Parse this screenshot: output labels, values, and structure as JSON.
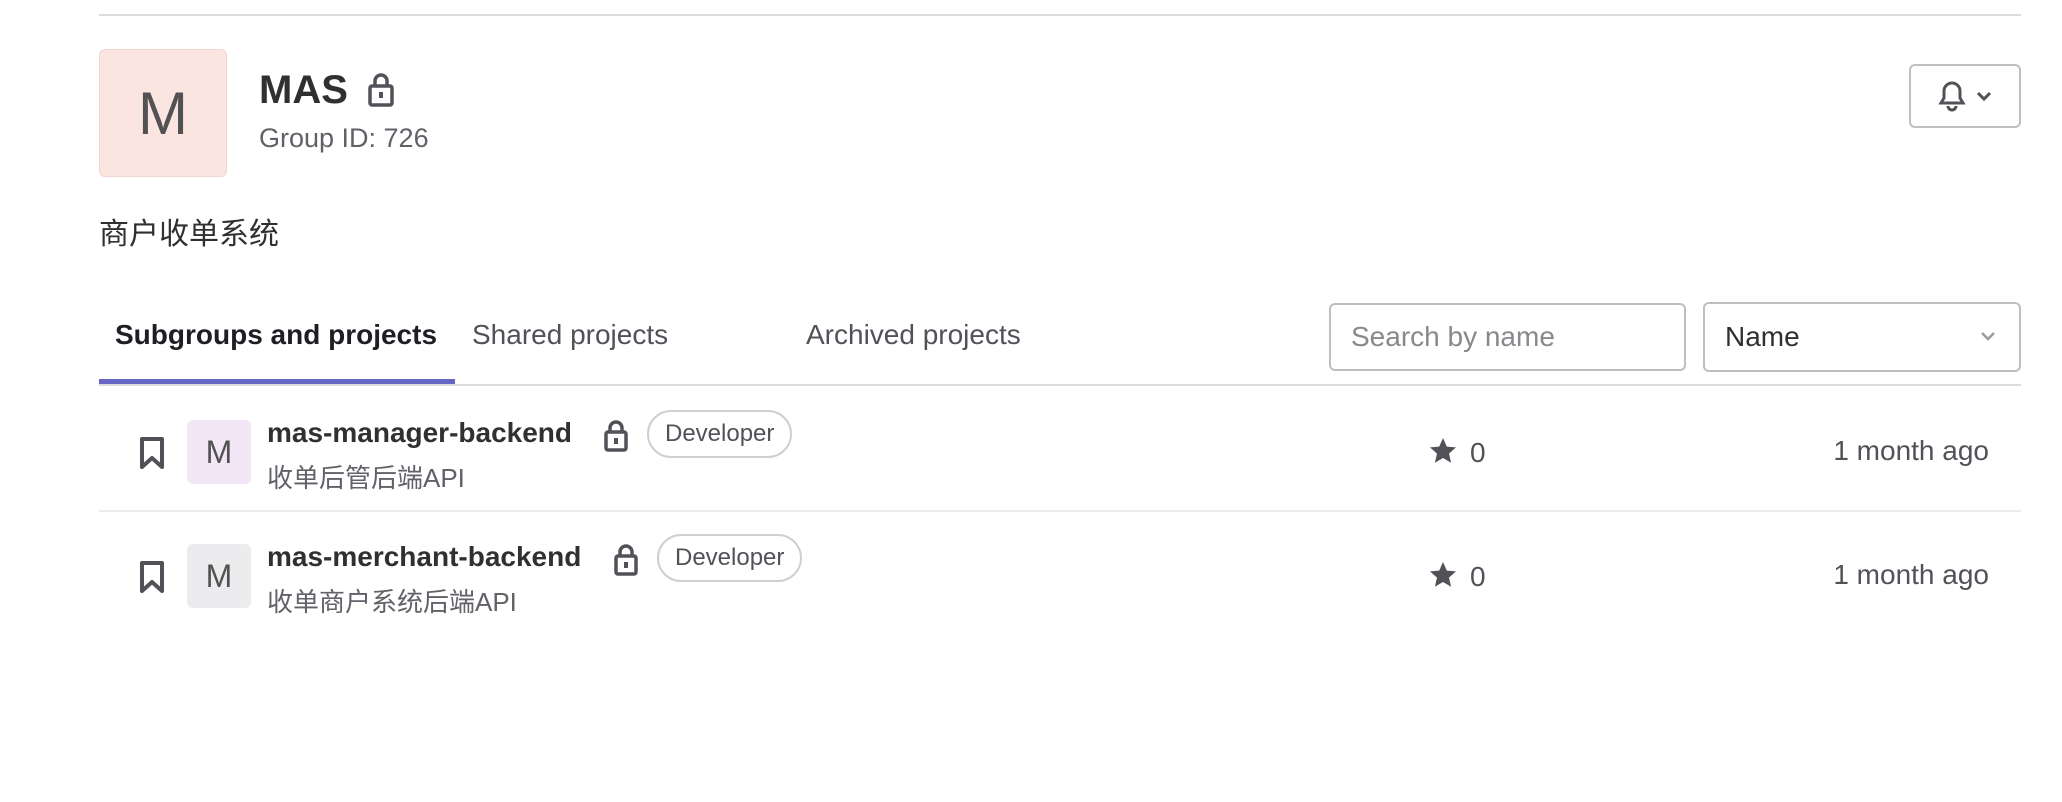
{
  "group": {
    "avatar_letter": "M",
    "name": "MAS",
    "id_text": "Group ID: 726",
    "description": "商户收单系统",
    "visibility_icon": "lock-icon",
    "avatar_color": "#fbe5e1"
  },
  "notifications": {
    "icon": "bell-icon",
    "dropdown_icon": "chevron-down-icon"
  },
  "tabs": [
    {
      "label": "Subgroups and projects",
      "active": true
    },
    {
      "label": "Shared projects",
      "active": false
    },
    {
      "label": "Archived projects",
      "active": false
    }
  ],
  "search": {
    "placeholder": "Search by name",
    "value": ""
  },
  "sort": {
    "selected": "Name"
  },
  "projects": [
    {
      "avatar_letter": "M",
      "avatar_color": "#f3e6f6",
      "name": "mas-manager-backend",
      "role": "Developer",
      "description": "收单后管后端API",
      "stars": "0",
      "updated": "1 month ago"
    },
    {
      "avatar_letter": "M",
      "avatar_color": "#ececef",
      "name": "mas-merchant-backend",
      "role": "Developer",
      "description": "收单商户系统后端API",
      "stars": "0",
      "updated": "1 month ago"
    }
  ],
  "colors": {
    "accent": "#6666c4",
    "border": "#bfbfc3"
  }
}
